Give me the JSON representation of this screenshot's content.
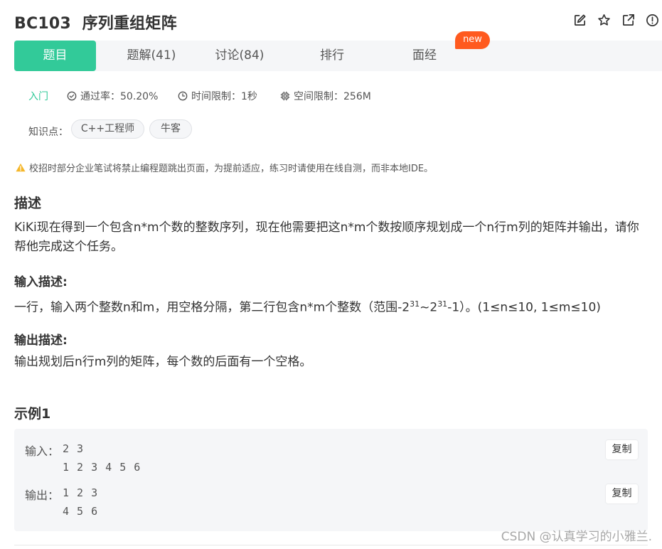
{
  "problem": {
    "code": "BC103",
    "name": "序列重组矩阵"
  },
  "tabs": [
    {
      "label": "题目",
      "active": true
    },
    {
      "label": "题解(41)"
    },
    {
      "label": "讨论(84)"
    },
    {
      "label": "排行"
    },
    {
      "label": "面经"
    }
  ],
  "new_badge": "new",
  "meta": {
    "level": "入门",
    "pass_rate": "通过率：50.20%",
    "time_limit": "时间限制：1秒",
    "memory_limit": "空间限制：256M"
  },
  "knowledge": {
    "label": "知识点：",
    "tags": [
      "C++工程师",
      "牛客"
    ]
  },
  "warning": "校招时部分企业笔试将禁止编程题跳出页面，为提前适应，练习时请使用在线自测，而非本地IDE。",
  "description": {
    "heading": "描述",
    "line1": "KiKi现在得到一个包含n*m个数的整数序列，现在他需要把这n*m个数按顺序规划成一个n行m列的矩阵并输出，请你",
    "line2": "帮他完成这个任务。"
  },
  "input_desc": {
    "heading": "输入描述:",
    "pre": "一行，输入两个整数n和m，用空格分隔，第二行包含n*m个整数（范围-2",
    "exp1": "31",
    "mid": "~2",
    "exp2": "31",
    "post": "-1）。(1≤n≤10, 1≤m≤10)"
  },
  "output_desc": {
    "heading": "输出描述:",
    "text": "输出规划后n行m列的矩阵，每个数的后面有一个空格。"
  },
  "example": {
    "heading": "示例1",
    "input_label": "输入：",
    "input_lines": [
      "2 3",
      "1 2 3 4 5 6"
    ],
    "output_label": "输出：",
    "output_lines": [
      "1 2 3",
      "4 5 6"
    ],
    "copy_label": "复制"
  },
  "watermark": "CSDN @认真学习的小雅兰.",
  "colors": {
    "accent": "#32ca99",
    "new_badge": "#ff5a1f",
    "warning": "#f5b72a"
  },
  "icons": [
    "edit-icon",
    "star-icon",
    "share-icon",
    "report-icon",
    "check-circle-icon",
    "clock-icon",
    "chip-icon",
    "warning-icon"
  ]
}
